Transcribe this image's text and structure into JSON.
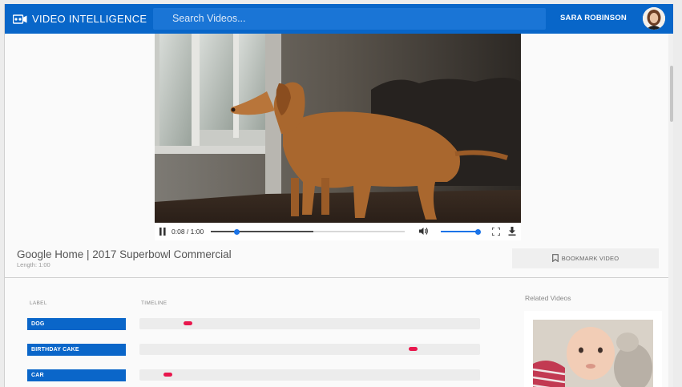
{
  "header": {
    "brand": "VIDEO INTELLIGENCE",
    "search_placeholder": "Search Videos...",
    "user_name": "SARA ROBINSON"
  },
  "player": {
    "time": "0:08 / 1:00",
    "progress_fraction": 0.133,
    "buffered_fraction": 0.53,
    "volume_fraction": 1.0
  },
  "video_info": {
    "title": "Google Home | 2017 Superbowl Commercial",
    "length": "Length: 1:00",
    "bookmark_label": "BOOKMARK VIDEO"
  },
  "labels_table": {
    "col_label": "LABEL",
    "col_timeline": "TIMELINE",
    "rows": [
      {
        "label": "DOG",
        "mark_fraction": 0.13
      },
      {
        "label": "BIRTHDAY CAKE",
        "mark_fraction": 0.79
      },
      {
        "label": "CAR",
        "mark_fraction": 0.07
      }
    ]
  },
  "related": {
    "title": "Related Videos"
  },
  "colors": {
    "header_blue": "#0866c9",
    "label_blue": "#0a66c9",
    "marker_red": "#e8174d",
    "accent_blue": "#1a73e8"
  }
}
